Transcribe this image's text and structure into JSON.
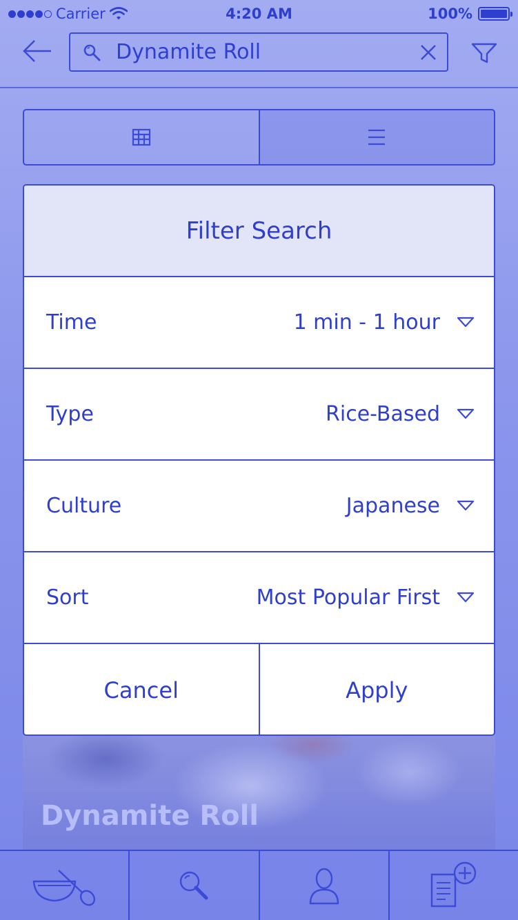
{
  "status_bar": {
    "carrier": "Carrier",
    "time": "4:20 AM",
    "battery_text": "100%",
    "battery_level": 1.0,
    "signal_bars_filled": 4,
    "signal_bars_total": 5
  },
  "nav": {
    "search_value": "Dynamite Roll"
  },
  "filter": {
    "title": "Filter Search",
    "rows": [
      {
        "label": "Time",
        "value": "1 min - 1 hour"
      },
      {
        "label": "Type",
        "value": "Rice-Based"
      },
      {
        "label": "Culture",
        "value": "Japanese"
      },
      {
        "label": "Sort",
        "value": "Most Popular First"
      }
    ],
    "cancel_label": "Cancel",
    "apply_label": "Apply"
  },
  "recipe": {
    "title": "Dynamite Roll"
  },
  "tabs": [
    "bowl-spoon-icon",
    "search-icon",
    "profile-icon",
    "add-recipe-icon"
  ],
  "colors": {
    "accent": "#2e3fd0",
    "background": "#8a95ec",
    "modal_header": "#e2e4f8"
  }
}
